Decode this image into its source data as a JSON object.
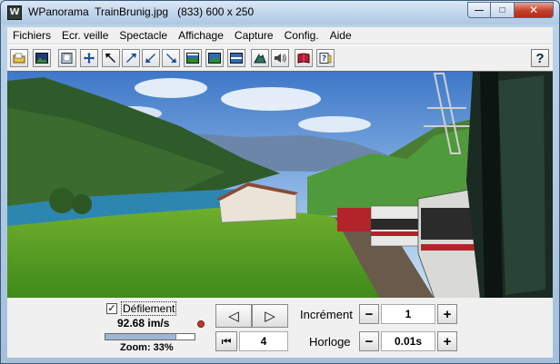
{
  "window": {
    "title": "WPanorama  TrainBrunig.jpg   (833) 600 x 250",
    "icon": "W",
    "controls": {
      "minimize": "—",
      "maximize": "□",
      "close": "✕"
    }
  },
  "menu": [
    "Fichiers",
    "Ecr. veille",
    "Spectacle",
    "Affichage",
    "Capture",
    "Config.",
    "Aide"
  ],
  "toolbar": {
    "icons": [
      "open-folder-icon",
      "landscape-image-icon",
      "window-frame-icon",
      "move-arrows-icon",
      "arrow-upleft-icon",
      "arrow-upright-icon",
      "arrow-downleft-icon",
      "arrow-downright-icon",
      "image-top-icon",
      "image-middle-icon",
      "image-bottom-icon",
      "mountain-icon",
      "speaker-icon",
      "book-icon",
      "help-document-icon"
    ],
    "help_label": "?"
  },
  "panel": {
    "scroll_checkbox_mark": "✓",
    "scroll_label": "Défilement",
    "speed": "92.68 im/s",
    "zoom_label": "Zoom: 33%",
    "zoom_fraction": 0.33,
    "prev_glyph": "◁",
    "next_glyph": "▷",
    "first_glyph": "⏮",
    "frame_value": "4",
    "increment_label": "Incrément",
    "increment_value": "1",
    "clock_label": "Horloge",
    "clock_value": "0.01s",
    "minus": "−",
    "plus": "+"
  }
}
